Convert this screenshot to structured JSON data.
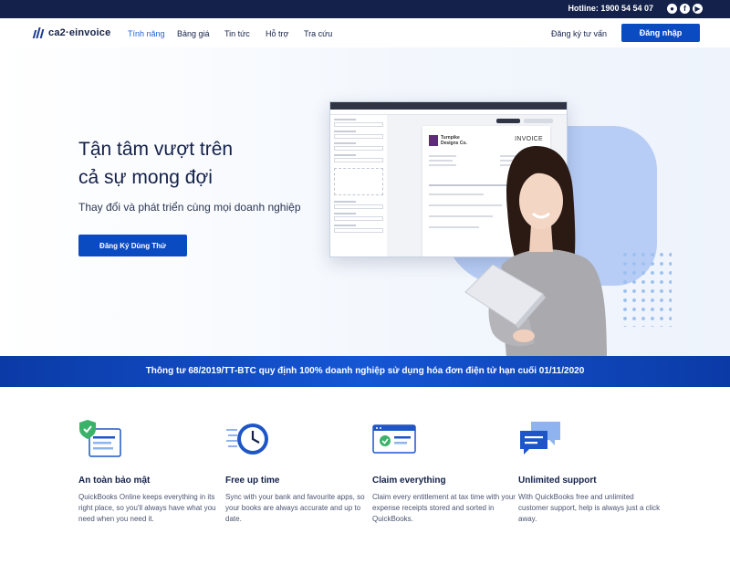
{
  "topbar": {
    "hotline": "Hotline: 1900 54 54 07",
    "social_icons": [
      "skype-icon",
      "facebook-icon",
      "youtube-icon"
    ]
  },
  "nav": {
    "logo_text": "ca2·einvoice",
    "links": [
      "Tính năng",
      "Bảng giá",
      "Tin tức",
      "Hỗ trợ",
      "Tra cứu"
    ],
    "consult": "Đăng ký tư vấn",
    "login": "Đăng nhập"
  },
  "hero": {
    "title_line1": "Tận tâm vượt trên",
    "title_line2": "cả sự mong đợi",
    "subtitle": "Thay đổi và phát triển cùng mọi doanh nghiệp",
    "cta": "Đăng Ký Dùng Thử",
    "invoice": {
      "company": "Turnpike Designs Co.",
      "heading": "INVOICE"
    }
  },
  "banner": {
    "text": "Thông tư 68/2019/TT-BTC quy định 100% doanh nghiệp sử dụng hóa đơn điện tử hạn cuối 01/11/2020"
  },
  "features": [
    {
      "title": "An toàn bảo mật",
      "desc": "QuickBooks Online keeps everything in its right place, so you'll always have what you need when you need it.",
      "icon": "shield-document-icon"
    },
    {
      "title": "Free up time",
      "desc": "Sync with your bank and favourite apps, so your books are always accurate and up to date.",
      "icon": "clock-icon"
    },
    {
      "title": "Claim everything",
      "desc": "Claim every entitlement at tax time with your expense receipts stored and sorted in QuickBooks.",
      "icon": "receipt-check-icon"
    },
    {
      "title": "Unlimited support",
      "desc": "With QuickBooks free and unlimited customer support, help is always just a click away.",
      "icon": "chat-bubbles-icon"
    }
  ],
  "colors": {
    "navy": "#14214a",
    "primary": "#0b4bc2",
    "accent": "#1b64d8",
    "banner": "#1556d4",
    "blob": "#b7cdf5"
  }
}
